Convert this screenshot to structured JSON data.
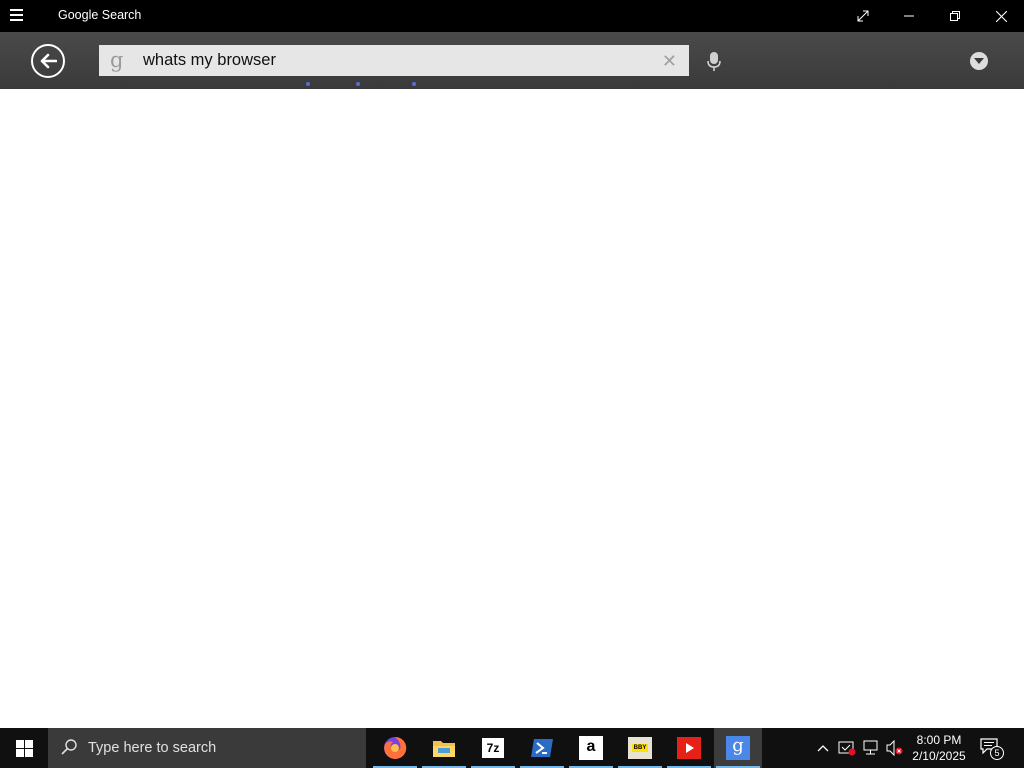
{
  "window": {
    "title": "Google Search",
    "controls": [
      "fullscreen-icon",
      "minimize-icon",
      "restore-icon",
      "close-icon"
    ]
  },
  "toolbar": {
    "search_query": "whats my browser",
    "icons": [
      "back-arrow-icon",
      "google-g-icon",
      "clear-icon",
      "microphone-icon",
      "dropdown-icon"
    ]
  },
  "taskbar": {
    "search_placeholder": "Type here to search",
    "pinned_apps": [
      {
        "name": "Firefox",
        "icon": "firefox-icon"
      },
      {
        "name": "File Explorer",
        "icon": "folder-icon"
      },
      {
        "name": "7-Zip",
        "label": "7z",
        "icon": "7zip-icon"
      },
      {
        "name": "PowerShell",
        "icon": "powershell-icon"
      },
      {
        "name": "Amazon",
        "label": "a",
        "icon": "amazon-icon"
      },
      {
        "name": "Best Buy",
        "label": "BBY",
        "icon": "bestbuy-icon"
      },
      {
        "name": "YouTube",
        "icon": "youtube-icon"
      },
      {
        "name": "Google Search",
        "label": "g",
        "icon": "google-g-icon",
        "active": true
      }
    ],
    "tray": {
      "time": "8:00 PM",
      "date": "2/10/2025",
      "notification_count": "5",
      "icons": [
        "chevron-up-icon",
        "security-icon",
        "network-icon",
        "volume-muted-icon",
        "action-center-icon"
      ]
    }
  },
  "colors": {
    "titlebar": "#000000",
    "toolbar": "#404040",
    "searchbox": "#e6e6e6",
    "taskbar": "#101010",
    "accent": "#76b9ed",
    "loading_dots": "#5b6cd6"
  }
}
